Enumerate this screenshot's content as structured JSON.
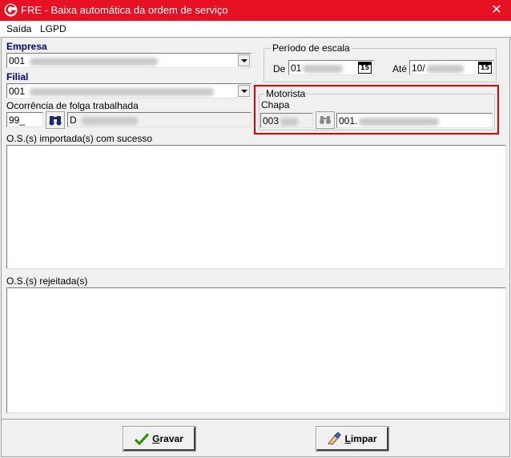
{
  "window": {
    "title": "FRE - Baixa automática da ordem de serviço",
    "close_glyph": "✕"
  },
  "menu": {
    "items": [
      "Saída",
      "LGPD"
    ]
  },
  "empresa": {
    "label": "Empresa",
    "value": "001"
  },
  "filial": {
    "label": "Filial",
    "value": "001"
  },
  "ocorrencia": {
    "label": "Ocorrência de folga trabalhada",
    "code": "99_",
    "description": "D"
  },
  "periodo": {
    "title": "Período de escala",
    "de_label": "De",
    "de_value": "01",
    "ate_label": "Até",
    "ate_value": "10/",
    "calendar_text": "15"
  },
  "motorista": {
    "title": "Motorista",
    "chapa_label": "Chapa",
    "chapa_value": "003",
    "name_value": "001."
  },
  "imported": {
    "label": "O.S.(s) importada(s) com sucesso"
  },
  "rejected": {
    "label": "O.S.(s) rejeitada(s)"
  },
  "buttons": {
    "gravar_first": "G",
    "gravar_rest": "ravar",
    "limpar_first": "L",
    "limpar_rest": "impar"
  },
  "colors": {
    "titlebar": "#e81123",
    "highlight": "#e00000",
    "label_blue": "#000080"
  }
}
